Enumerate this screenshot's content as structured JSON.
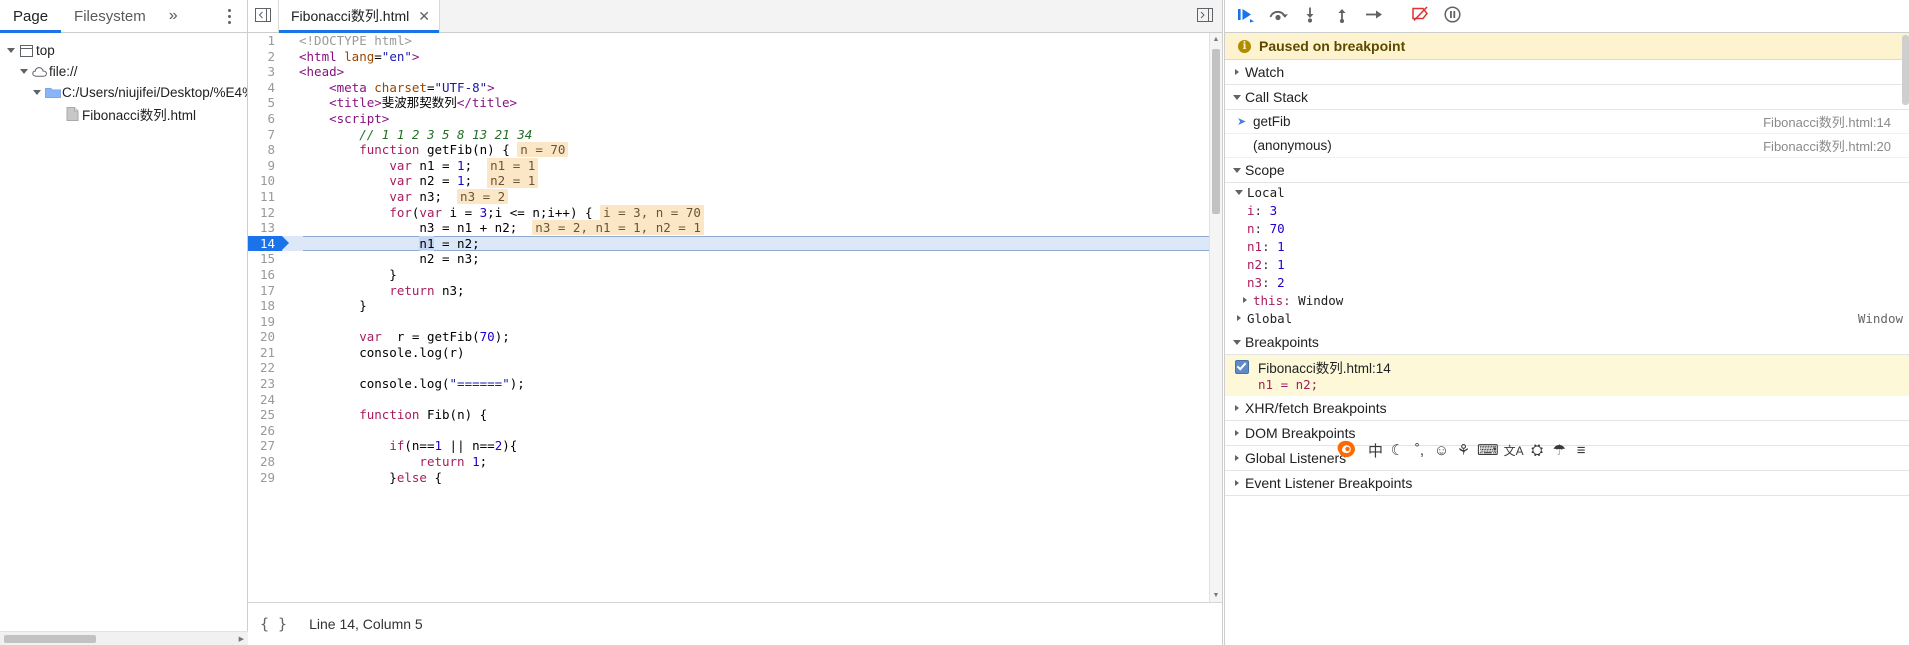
{
  "navigator": {
    "tabs": [
      {
        "label": "Page",
        "selected": true
      },
      {
        "label": "Filesystem",
        "selected": false
      }
    ],
    "more_label": "»",
    "tree": [
      {
        "label": "top",
        "icon": "frame-icon",
        "depth": 0,
        "expanded": true
      },
      {
        "label": "file://",
        "icon": "cloud-icon",
        "depth": 1,
        "expanded": true
      },
      {
        "label": "C:/Users/niujifei/Desktop/%E4%",
        "icon": "folder-icon",
        "depth": 2,
        "expanded": true
      },
      {
        "label": "Fibonacci数列.html",
        "icon": "file-icon",
        "depth": 3,
        "expanded": null
      }
    ]
  },
  "editor": {
    "tab_label": "Fibonacci数列.html",
    "tab_close": "✕",
    "panel_toggle_icon": "show-navigator-icon",
    "show_drawer_icon": "show-drawer-icon",
    "format_button": "{ }",
    "status": "Line 14, Column 5",
    "current_line": 14,
    "lines": [
      {
        "n": 1,
        "tokens": [
          {
            "t": "doctype",
            "v": "<!DOCTYPE html>"
          }
        ]
      },
      {
        "n": 2,
        "tokens": [
          {
            "t": "tag",
            "v": "<html "
          },
          {
            "t": "attr",
            "v": "lang"
          },
          {
            "t": "plain",
            "v": "="
          },
          {
            "t": "str",
            "v": "\"en\""
          },
          {
            "t": "tag",
            "v": ">"
          }
        ]
      },
      {
        "n": 3,
        "tokens": [
          {
            "t": "tag",
            "v": "<head>"
          }
        ]
      },
      {
        "n": 4,
        "tokens": [
          {
            "t": "plain",
            "v": "    "
          },
          {
            "t": "tag",
            "v": "<meta "
          },
          {
            "t": "attr",
            "v": "charset"
          },
          {
            "t": "plain",
            "v": "="
          },
          {
            "t": "str",
            "v": "\"UTF-8\""
          },
          {
            "t": "tag",
            "v": ">"
          }
        ]
      },
      {
        "n": 5,
        "tokens": [
          {
            "t": "plain",
            "v": "    "
          },
          {
            "t": "tag",
            "v": "<title>"
          },
          {
            "t": "plain",
            "v": "斐波那契数列"
          },
          {
            "t": "tag",
            "v": "</title>"
          }
        ]
      },
      {
        "n": 6,
        "tokens": [
          {
            "t": "plain",
            "v": "    "
          },
          {
            "t": "tag",
            "v": "<script>"
          }
        ]
      },
      {
        "n": 7,
        "tokens": [
          {
            "t": "plain",
            "v": "        "
          },
          {
            "t": "com",
            "v": "// 1 1 2 3 5 8 13 21 34"
          }
        ]
      },
      {
        "n": 8,
        "tokens": [
          {
            "t": "plain",
            "v": "        "
          },
          {
            "t": "kw",
            "v": "function"
          },
          {
            "t": "plain",
            "v": " getFib(n) { "
          },
          {
            "t": "val",
            "v": "n = 70"
          }
        ]
      },
      {
        "n": 9,
        "tokens": [
          {
            "t": "plain",
            "v": "            "
          },
          {
            "t": "kw",
            "v": "var"
          },
          {
            "t": "plain",
            "v": " n1 = "
          },
          {
            "t": "num",
            "v": "1"
          },
          {
            "t": "plain",
            "v": ";  "
          },
          {
            "t": "val",
            "v": "n1 = 1"
          }
        ]
      },
      {
        "n": 10,
        "tokens": [
          {
            "t": "plain",
            "v": "            "
          },
          {
            "t": "kw",
            "v": "var"
          },
          {
            "t": "plain",
            "v": " n2 = "
          },
          {
            "t": "num",
            "v": "1"
          },
          {
            "t": "plain",
            "v": ";  "
          },
          {
            "t": "val",
            "v": "n2 = 1"
          }
        ]
      },
      {
        "n": 11,
        "tokens": [
          {
            "t": "plain",
            "v": "            "
          },
          {
            "t": "kw",
            "v": "var"
          },
          {
            "t": "plain",
            "v": " n3;  "
          },
          {
            "t": "val",
            "v": "n3 = 2"
          }
        ]
      },
      {
        "n": 12,
        "tokens": [
          {
            "t": "plain",
            "v": "            "
          },
          {
            "t": "kw",
            "v": "for"
          },
          {
            "t": "plain",
            "v": "("
          },
          {
            "t": "kw",
            "v": "var"
          },
          {
            "t": "plain",
            "v": " i = "
          },
          {
            "t": "num",
            "v": "3"
          },
          {
            "t": "plain",
            "v": ";i <= n;i++) { "
          },
          {
            "t": "val",
            "v": "i = 3, n = 70"
          }
        ]
      },
      {
        "n": 13,
        "tokens": [
          {
            "t": "plain",
            "v": "                n3 = n1 + n2;  "
          },
          {
            "t": "val",
            "v": "n3 = 2, n1 = 1, n2 = 1"
          }
        ]
      },
      {
        "n": 14,
        "tokens": [
          {
            "t": "plain",
            "v": "                "
          },
          {
            "t": "hl",
            "v": "n1"
          },
          {
            "t": "plain",
            "v": " = n2;"
          }
        ]
      },
      {
        "n": 15,
        "tokens": [
          {
            "t": "plain",
            "v": "                n2 = n3;"
          }
        ]
      },
      {
        "n": 16,
        "tokens": [
          {
            "t": "plain",
            "v": "            }"
          }
        ]
      },
      {
        "n": 17,
        "tokens": [
          {
            "t": "plain",
            "v": "            "
          },
          {
            "t": "kw",
            "v": "return"
          },
          {
            "t": "plain",
            "v": " n3;"
          }
        ]
      },
      {
        "n": 18,
        "tokens": [
          {
            "t": "plain",
            "v": "        }"
          }
        ]
      },
      {
        "n": 19,
        "tokens": [
          {
            "t": "plain",
            "v": ""
          }
        ]
      },
      {
        "n": 20,
        "tokens": [
          {
            "t": "plain",
            "v": "        "
          },
          {
            "t": "kw",
            "v": "var"
          },
          {
            "t": "plain",
            "v": "  r = getFib("
          },
          {
            "t": "num",
            "v": "70"
          },
          {
            "t": "plain",
            "v": ");"
          }
        ]
      },
      {
        "n": 21,
        "tokens": [
          {
            "t": "plain",
            "v": "        console.log(r)"
          }
        ]
      },
      {
        "n": 22,
        "tokens": [
          {
            "t": "plain",
            "v": ""
          }
        ]
      },
      {
        "n": 23,
        "tokens": [
          {
            "t": "plain",
            "v": "        console.log("
          },
          {
            "t": "str",
            "v": "\"======\""
          },
          {
            "t": "plain",
            "v": ");"
          }
        ]
      },
      {
        "n": 24,
        "tokens": [
          {
            "t": "plain",
            "v": ""
          }
        ]
      },
      {
        "n": 25,
        "tokens": [
          {
            "t": "plain",
            "v": "        "
          },
          {
            "t": "kw",
            "v": "function"
          },
          {
            "t": "plain",
            "v": " Fib(n) {"
          }
        ]
      },
      {
        "n": 26,
        "tokens": [
          {
            "t": "plain",
            "v": ""
          }
        ]
      },
      {
        "n": 27,
        "tokens": [
          {
            "t": "plain",
            "v": "            "
          },
          {
            "t": "kw",
            "v": "if"
          },
          {
            "t": "plain",
            "v": "(n=="
          },
          {
            "t": "num",
            "v": "1"
          },
          {
            "t": "plain",
            "v": " || n=="
          },
          {
            "t": "num",
            "v": "2"
          },
          {
            "t": "plain",
            "v": "){"
          }
        ]
      },
      {
        "n": 28,
        "tokens": [
          {
            "t": "plain",
            "v": "                "
          },
          {
            "t": "kw",
            "v": "return"
          },
          {
            "t": "plain",
            "v": " "
          },
          {
            "t": "num",
            "v": "1"
          },
          {
            "t": "plain",
            "v": ";"
          }
        ]
      },
      {
        "n": 29,
        "tokens": [
          {
            "t": "plain",
            "v": "            }"
          },
          {
            "t": "kw",
            "v": "else"
          },
          {
            "t": "plain",
            "v": " {"
          }
        ]
      }
    ]
  },
  "debugger": {
    "toolbar_buttons": [
      {
        "name": "resume-script-execution",
        "icon": "resume-icon"
      },
      {
        "name": "step-over-next-function-call",
        "icon": "step-over-icon"
      },
      {
        "name": "step-into-next-function-call",
        "icon": "step-into-icon"
      },
      {
        "name": "step-out-of-current-function",
        "icon": "step-out-icon"
      },
      {
        "name": "step",
        "icon": "step-icon"
      },
      {
        "name": "deactivate-breakpoints",
        "icon": "deactivate-breakpoints-icon"
      },
      {
        "name": "pause-on-exceptions",
        "icon": "pause-on-exceptions-icon"
      }
    ],
    "paused_banner": "Paused on breakpoint",
    "sections": {
      "watch": {
        "label": "Watch",
        "expanded": false
      },
      "call_stack": {
        "label": "Call Stack",
        "expanded": true
      },
      "scope": {
        "label": "Scope",
        "expanded": true
      },
      "breakpoints": {
        "label": "Breakpoints",
        "expanded": true
      },
      "xhr": {
        "label": "XHR/fetch Breakpoints",
        "expanded": false
      },
      "dom": {
        "label": "DOM Breakpoints",
        "expanded": false
      },
      "global_listeners": {
        "label": "Global Listeners",
        "expanded": false
      },
      "event_listener_breakpoints": {
        "label": "Event Listener Breakpoints",
        "expanded": false
      }
    },
    "call_stack": [
      {
        "name": "getFib",
        "location": "Fibonacci数列.html:14",
        "current": true
      },
      {
        "name": "(anonymous)",
        "location": "Fibonacci数列.html:20",
        "current": false
      }
    ],
    "scope": {
      "local_label": "Local",
      "local_vars": [
        {
          "key": "i",
          "value": "3"
        },
        {
          "key": "n",
          "value": "70"
        },
        {
          "key": "n1",
          "value": "1"
        },
        {
          "key": "n2",
          "value": "1"
        },
        {
          "key": "n3",
          "value": "2"
        }
      ],
      "this_label": "this:",
      "this_value": "Window",
      "global_label": "Global",
      "global_value": "Window"
    },
    "breakpoints": [
      {
        "location": "Fibonacci数列.html:14",
        "code": "n1 = n2;",
        "checked": true
      }
    ]
  },
  "ime_bar": {
    "logo": "sogou-logo",
    "items": [
      {
        "name": "input-mode-chinese",
        "glyph": "中"
      },
      {
        "name": "moon-icon",
        "glyph": "☾"
      },
      {
        "name": "punctuation-icon",
        "glyph": "˚,"
      },
      {
        "name": "emoji-icon",
        "glyph": "☺"
      },
      {
        "name": "voice-input-icon",
        "glyph": "⚘"
      },
      {
        "name": "keyboard-icon",
        "glyph": "⌨"
      },
      {
        "name": "translate-icon",
        "glyph": "文A"
      },
      {
        "name": "toolbox-icon",
        "glyph": "⛭"
      },
      {
        "name": "skin-icon",
        "glyph": "☂"
      },
      {
        "name": "menu-icon",
        "glyph": "≡"
      }
    ]
  }
}
